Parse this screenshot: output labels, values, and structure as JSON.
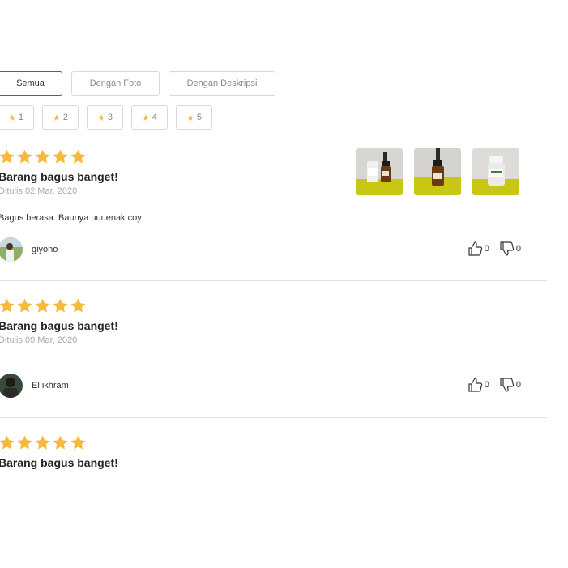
{
  "filters": {
    "tabs": [
      {
        "label": "Semua",
        "active": true
      },
      {
        "label": "Dengan Foto",
        "active": false
      },
      {
        "label": "Dengan Deskripsi",
        "active": false
      }
    ],
    "ratings": [
      "1",
      "2",
      "3",
      "4",
      "5"
    ]
  },
  "reviews": [
    {
      "rating": 5,
      "title": "Barang bagus banget!",
      "date": "Ditulis 02 Mar, 2020",
      "body": "Bagus berasa. Baunya uuuenak coy",
      "user": "giyono",
      "likes": "0",
      "dislikes": "0",
      "photos": [
        "product-photo-1",
        "product-photo-2",
        "product-photo-3"
      ]
    },
    {
      "rating": 5,
      "title": "Barang bagus banget!",
      "date": "Ditulis 09 Mar, 2020",
      "user": "El ikhram",
      "likes": "0",
      "dislikes": "0"
    },
    {
      "rating": 5,
      "title": "Barang bagus banget!"
    }
  ],
  "colors": {
    "accent": "#a7375b",
    "star": "#f6b93b",
    "photo_bg": "#c8c814"
  }
}
